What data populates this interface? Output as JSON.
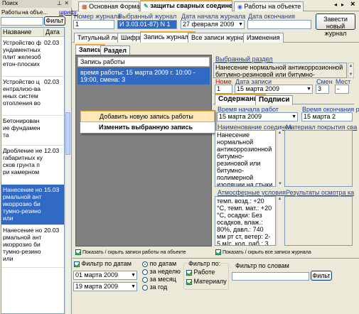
{
  "left_panel": {
    "title": "Поиск",
    "pin_icon": "pin-icon",
    "close_icon": "close-icon",
    "works_label": "Работы",
    "filter_label": "на объе...",
    "font_link": "шрифт",
    "filter_button": "Фильт",
    "columns": [
      "Название",
      "Дата"
    ],
    "rows": [
      {
        "name": "Устройство фундаментных плит железобетон-плоских",
        "date": "02.03",
        "selected": false
      },
      {
        "name": "Устройство централизо-ванных систем отопления во",
        "date": "02.03",
        "selected": false
      },
      {
        "name": "Бетонирование фундамента",
        "date": "",
        "selected": false
      },
      {
        "name": "Дробление негабаритных кусков грунта при камерном",
        "date": "12.03",
        "selected": false
      },
      {
        "name": "Нанесение нормальной антикоррозио битумно-резино или",
        "date": "15.03",
        "selected": true
      },
      {
        "name": "Нанесение нормальной антикоррозио битумно-резино или",
        "date": "20.03",
        "selected": false
      }
    ]
  },
  "tabs": [
    {
      "label": "Основная Форма",
      "icon": "form-icon",
      "active": false
    },
    {
      "label": "защиты сварных соединени",
      "icon": "journal-icon",
      "active": true
    },
    {
      "label": "Работы на объекте",
      "icon": "works-icon",
      "active": false
    }
  ],
  "header": {
    "journal_number_label": "Номер журнала",
    "journal_number": "1",
    "selected_journal_label": "Выбранный журнал",
    "selected_journal": "И 3.03.01-87) N 1",
    "start_date_label": "Дата начала журнала",
    "start_date": "27 февраля 2009",
    "end_date_label": "Дата окончания",
    "end_date": "",
    "new_journal_button": "Завести новый журнал"
  },
  "subtabs": [
    "Титульный лист",
    "Шифры",
    "Запись журнала",
    "Все записи журнала",
    "Изменения"
  ],
  "inner_tabs": [
    "Запись",
    "Раздел"
  ],
  "works_list": {
    "header": "Запись работы",
    "item": "время работы: 15 марта 2009 г.  10:00 - 19:00, смена: 3"
  },
  "context_menu": {
    "items": [
      "Добавить новую запись работы",
      "Изменить выбранную запись"
    ]
  },
  "section": {
    "label": "Выбранный раздел",
    "text": "Нанесение нормальной антикоррозионной битумно-резиновой или битумно-полимерной"
  },
  "record": {
    "number_label": "Номе",
    "number": "1",
    "date_label": "Дата записи",
    "date": "15  марта  2009",
    "shift_label": "Смен",
    "shift": "3",
    "place_label": "Мест",
    "place": "-"
  },
  "content_tabs": [
    "Содержание",
    "Подписи"
  ],
  "work_time": {
    "start_label": "Время начала работ",
    "start_date": "15  марта  2009",
    "end_label": "Время окончания ра",
    "end_date": "15  марта  2"
  },
  "name_box": {
    "label": "Наименование соединен",
    "text": "Нанесение нормальной антикоррозионной битумно-резиновой или битумно-полимерной изоляции на стыки и фасонные части стальных"
  },
  "material_label": "Материал покрытия сва",
  "atmosphere": {
    "label": "Атмосферные условия",
    "text": "темп. возд.: +20 °С, темп. мат.: +20 °С, осадки: Без осадков, влаж.: 80%, давл.: 740 мм рт ст, ветер: 2-5 м/с, кол. раб.: 3,"
  },
  "inspection_label": "Результаты осмотра ка",
  "toggles": {
    "left": "Показать / скрыть записи работы на объекте",
    "right": "Показать / скрыть все записи журнала"
  },
  "filter": {
    "by_date_label": "Фильтр по датам",
    "date_from": "01   марта   2009",
    "date_to": "19   марта   2009",
    "radios": [
      "по датам",
      "за неделю",
      "за месяц",
      "за год"
    ],
    "filter_by_label": "Фильтр по:",
    "by_work": "Работе",
    "by_material": "Материалу",
    "by_words_label": "Фильтр по словам",
    "words_value": "",
    "filter_button": "Фильт"
  },
  "colors": {
    "selection": "#316ac5",
    "label_blue": "#1e3fa0",
    "tab_accent": "#e8a93b"
  }
}
